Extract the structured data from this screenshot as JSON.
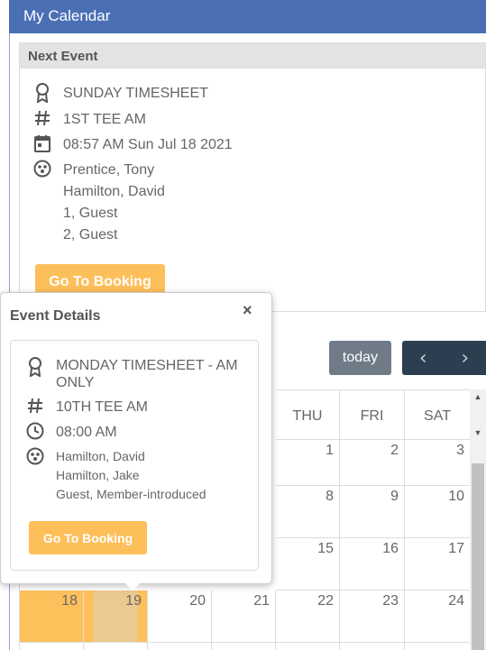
{
  "header": {
    "title": "My Calendar"
  },
  "next_event": {
    "heading": "Next Event",
    "title": "SUNDAY TIMESHEET",
    "tee": "1ST TEE AM",
    "datetime": "08:57 AM Sun Jul 18 2021",
    "players": [
      "Prentice, Tony",
      "Hamilton, David",
      "1, Guest",
      "2, Guest"
    ],
    "button_label": "Go To Booking"
  },
  "toolbar": {
    "today_label": "today",
    "prev_icon": "‹",
    "next_icon": "›"
  },
  "calendar": {
    "weekdays": [
      "THU",
      "FRI",
      "SAT"
    ],
    "week1": [
      "1",
      "2",
      "3"
    ],
    "week2": [
      "8",
      "9",
      "10"
    ],
    "week3": [
      "15",
      "16",
      "17"
    ],
    "week4": [
      "18",
      "19",
      "20",
      "21",
      "22",
      "23",
      "24"
    ]
  },
  "popover": {
    "heading": "Event Details",
    "close_icon": "×",
    "title": "MONDAY TIMESHEET - AM ONLY",
    "tee": "10TH TEE AM",
    "time": "08:00 AM",
    "players": [
      "Hamilton, David",
      "Hamilton, Jake",
      "Guest, Member-introduced"
    ],
    "button_label": "Go To Booking"
  },
  "colors": {
    "header_bg": "#4a6fb5",
    "booking_button": "#fdbf5a",
    "highlight": "#fdc05a",
    "nav_bg": "#2c3e50",
    "today_bg": "#6f7b87"
  }
}
